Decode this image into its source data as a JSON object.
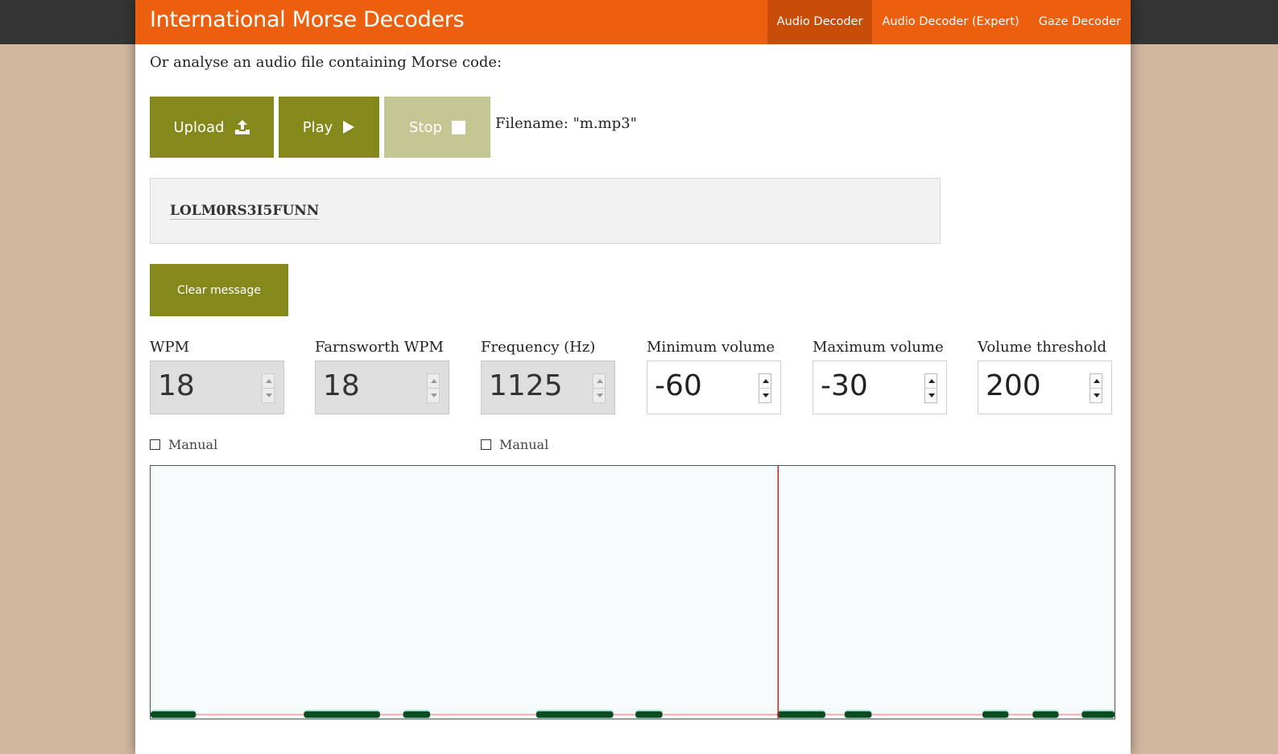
{
  "header": {
    "title": "International Morse Decoders",
    "nav": [
      {
        "label": "Audio Decoder",
        "active": true
      },
      {
        "label": "Audio Decoder (Expert)",
        "active": false
      },
      {
        "label": "Gaze Decoder",
        "active": false
      }
    ]
  },
  "intro": "Or analyse an audio file containing Morse code:",
  "controls": {
    "upload_label": "Upload",
    "play_label": "Play",
    "stop_label": "Stop",
    "filename": "Filename: \"m.mp3\""
  },
  "message": "LOLM0RS3I5FUNN",
  "clear_label": "Clear message",
  "fields": {
    "wpm": {
      "label": "WPM",
      "value": "18",
      "disabled": true
    },
    "farnsworth": {
      "label": "Farnsworth WPM",
      "value": "18",
      "disabled": true
    },
    "frequency": {
      "label": "Frequency (Hz)",
      "value": "1125",
      "disabled": true
    },
    "min_volume": {
      "label": "Minimum volume",
      "value": "-60",
      "disabled": false
    },
    "max_volume": {
      "label": "Maximum volume",
      "value": "-30",
      "disabled": false
    },
    "threshold": {
      "label": "Volume threshold",
      "value": "200",
      "disabled": false
    }
  },
  "manual_wpm_label": "Manual",
  "manual_freq_label": "Manual",
  "colors": {
    "header": "#ec5f0f",
    "nav_active": "#c84d09",
    "button": "#85891c",
    "button_disabled": "#c4c793",
    "signal": "#0b4d1f",
    "cursor": "#e02020"
  },
  "timeline": {
    "cursor_fraction": 0.651,
    "signal_segments": [
      [
        0.0,
        0.047
      ],
      [
        0.159,
        0.238
      ],
      [
        0.262,
        0.29
      ],
      [
        0.4,
        0.48
      ],
      [
        0.503,
        0.531
      ],
      [
        0.65,
        0.7
      ],
      [
        0.72,
        0.748
      ],
      [
        0.863,
        0.89
      ],
      [
        0.915,
        0.942
      ],
      [
        0.966,
        1.0
      ]
    ]
  }
}
